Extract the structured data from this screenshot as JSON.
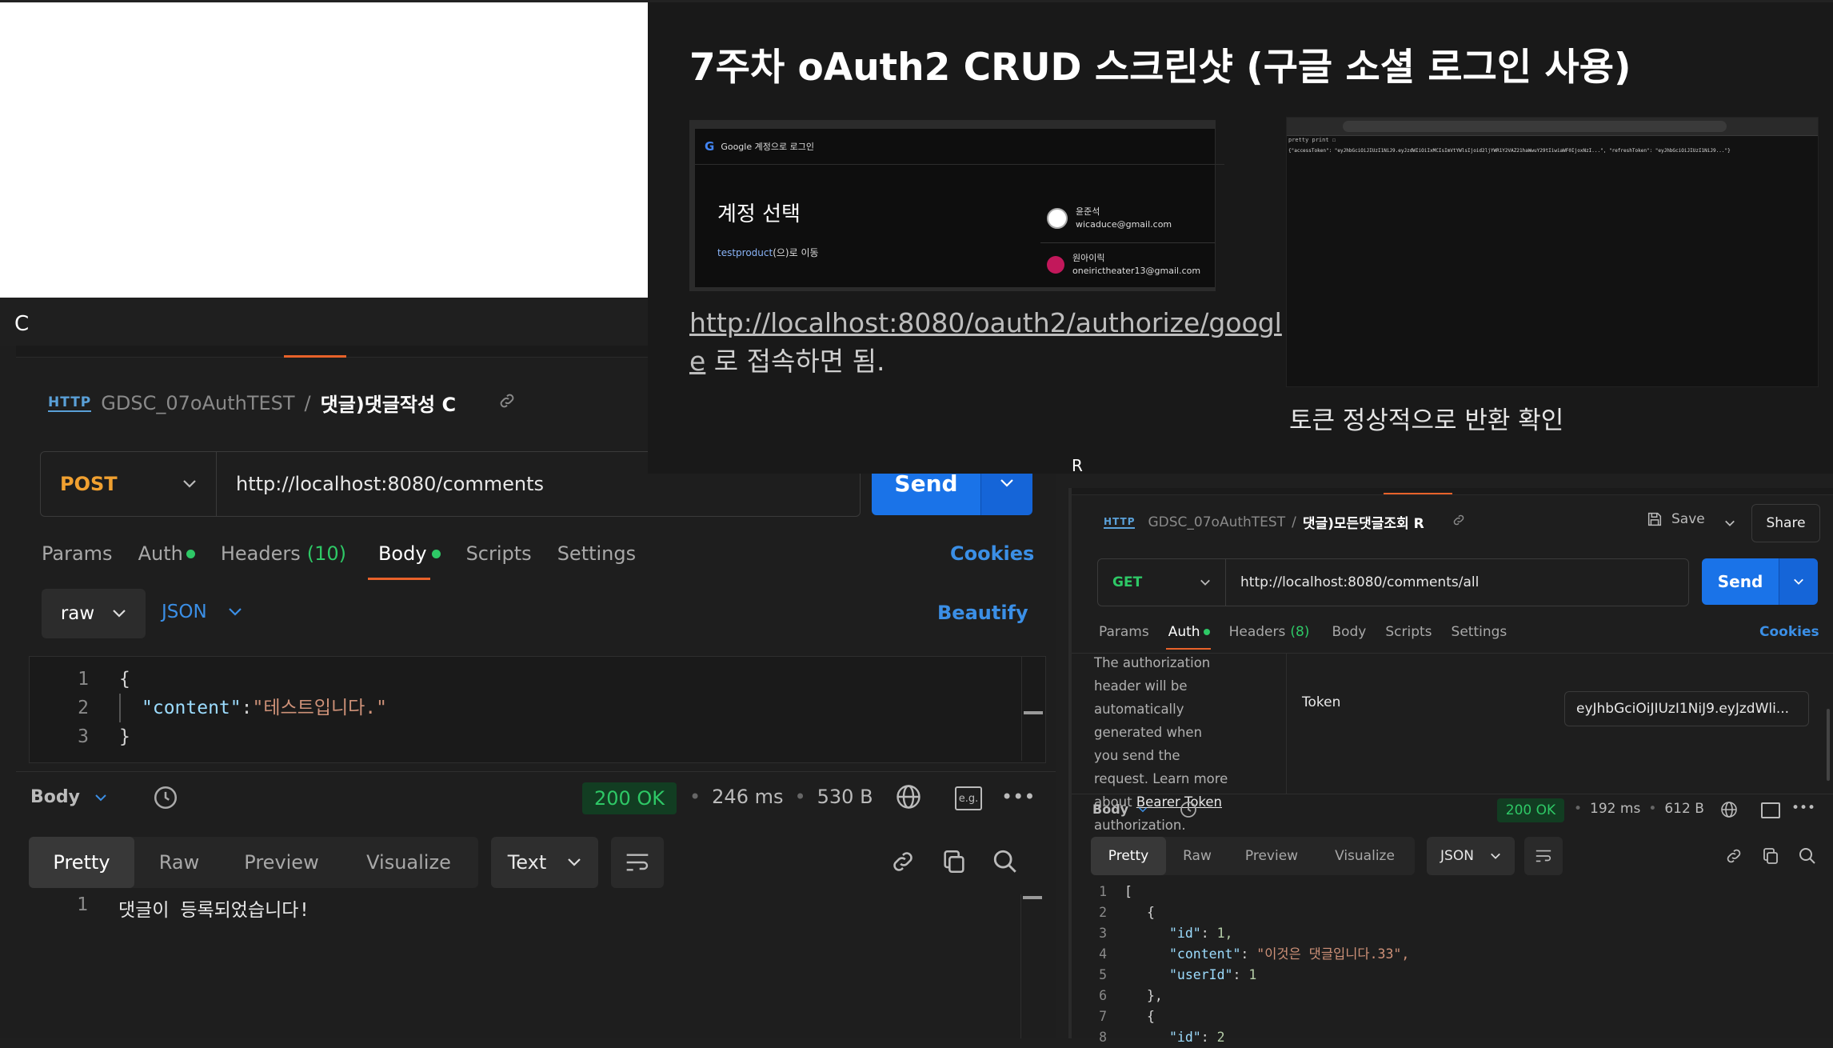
{
  "slide": {
    "title": "7주차 oAuth2 CRUD 스크린샷 (구글 소셜 로그인 사용)",
    "google_login": {
      "header": "Google 계정으로 로그인",
      "heading": "계정 선택",
      "sub_link": "testproduct",
      "sub_suffix": "(으)로 이동",
      "accounts": [
        {
          "name": "윤준석",
          "email": "wicaduce@gmail.com"
        },
        {
          "name": "원아이릭",
          "email": "oneirictheater13@gmail.com"
        }
      ]
    },
    "link_url": "http://localhost:8080/oauth2/authorize/googl",
    "link_url_tail": "e",
    "link_suffix": " 로 접속하면 됨.",
    "caption2": "토큰 정상적으로 반환 확인",
    "token_screenshot": {
      "pretty_print": "pretty print ☐",
      "json_text": "{\"accessToken\": \"eyJhbGciOiJIUzI1NiJ9.eyJzdWIiOiIxMCIsImVtYWlsIjoid2ljYWR1Y2VAZ21haWwuY29tIiwiaWF0IjoxNzI...\", \"refreshToken\": \"eyJhbGciOiJIUzI1NiJ9...\"}"
    }
  },
  "labels": {
    "c": "C",
    "r": "R"
  },
  "left": {
    "crumb_collection": "GDSC_07oAuthTEST",
    "crumb_sep": "/",
    "crumb_request": "댓글)댓글작성 C",
    "method": "POST",
    "url": "http://localhost:8080/comments",
    "send": "Send",
    "tabs": {
      "params": "Params",
      "auth": "Auth",
      "headers": "Headers",
      "headers_count": "(10)",
      "body": "Body",
      "scripts": "Scripts",
      "settings": "Settings"
    },
    "cookies": "Cookies",
    "body_mode": "raw",
    "body_lang": "JSON",
    "beautify": "Beautify",
    "request_code": [
      {
        "n": "1",
        "text": "{"
      },
      {
        "n": "2",
        "key": "\"content\"",
        "colon": ":",
        "val": "\"테스트입니다.\""
      },
      {
        "n": "3",
        "text": "}"
      }
    ],
    "resp_label": "Body",
    "status": "200 OK",
    "time": "246 ms",
    "size": "530 B",
    "eg": "e.g.",
    "resp_views": [
      "Pretty",
      "Raw",
      "Preview",
      "Visualize"
    ],
    "resp_format": "Text",
    "response_line_no": "1",
    "response_text": "댓글이 등록되었습니다!"
  },
  "right": {
    "crumb_collection": "GDSC_07oAuthTEST",
    "crumb_sep": "/",
    "crumb_request": "댓글)모든댓글조회 R",
    "save": "Save",
    "share": "Share",
    "method": "GET",
    "url": "http://localhost:8080/comments/all",
    "send": "Send",
    "tabs": {
      "params": "Params",
      "auth": "Auth",
      "headers": "Headers",
      "headers_count": "(8)",
      "body": "Body",
      "scripts": "Scripts",
      "settings": "Settings"
    },
    "cookies": "Cookies",
    "auth_help_1": "The authorization header will be automatically generated when you send the request. Learn more about ",
    "auth_help_link": "Bearer Token",
    "auth_help_2": " authorization.",
    "token_label": "Token",
    "token_value": "eyJhbGciOiJIUzI1NiJ9.eyJzdWli...",
    "resp_label": "Body",
    "status": "200 OK",
    "time": "192 ms",
    "size": "612 B",
    "resp_views": [
      "Pretty",
      "Raw",
      "Preview",
      "Visualize"
    ],
    "resp_format": "JSON",
    "response_lines": [
      {
        "n": "1",
        "ind": 0,
        "text": "["
      },
      {
        "n": "2",
        "ind": 1,
        "text": "{"
      },
      {
        "n": "3",
        "ind": 2,
        "key": "\"id\"",
        "val": " 1,",
        "type": "num"
      },
      {
        "n": "4",
        "ind": 2,
        "key": "\"content\"",
        "val": " \"이것은 댓글입니다.33\",",
        "type": "str"
      },
      {
        "n": "5",
        "ind": 2,
        "key": "\"userId\"",
        "val": " 1",
        "type": "num"
      },
      {
        "n": "6",
        "ind": 1,
        "text": "},"
      },
      {
        "n": "7",
        "ind": 1,
        "text": "{"
      },
      {
        "n": "8",
        "ind": 2,
        "key": "\"id\"",
        "val": " 2",
        "type": "num"
      }
    ]
  }
}
